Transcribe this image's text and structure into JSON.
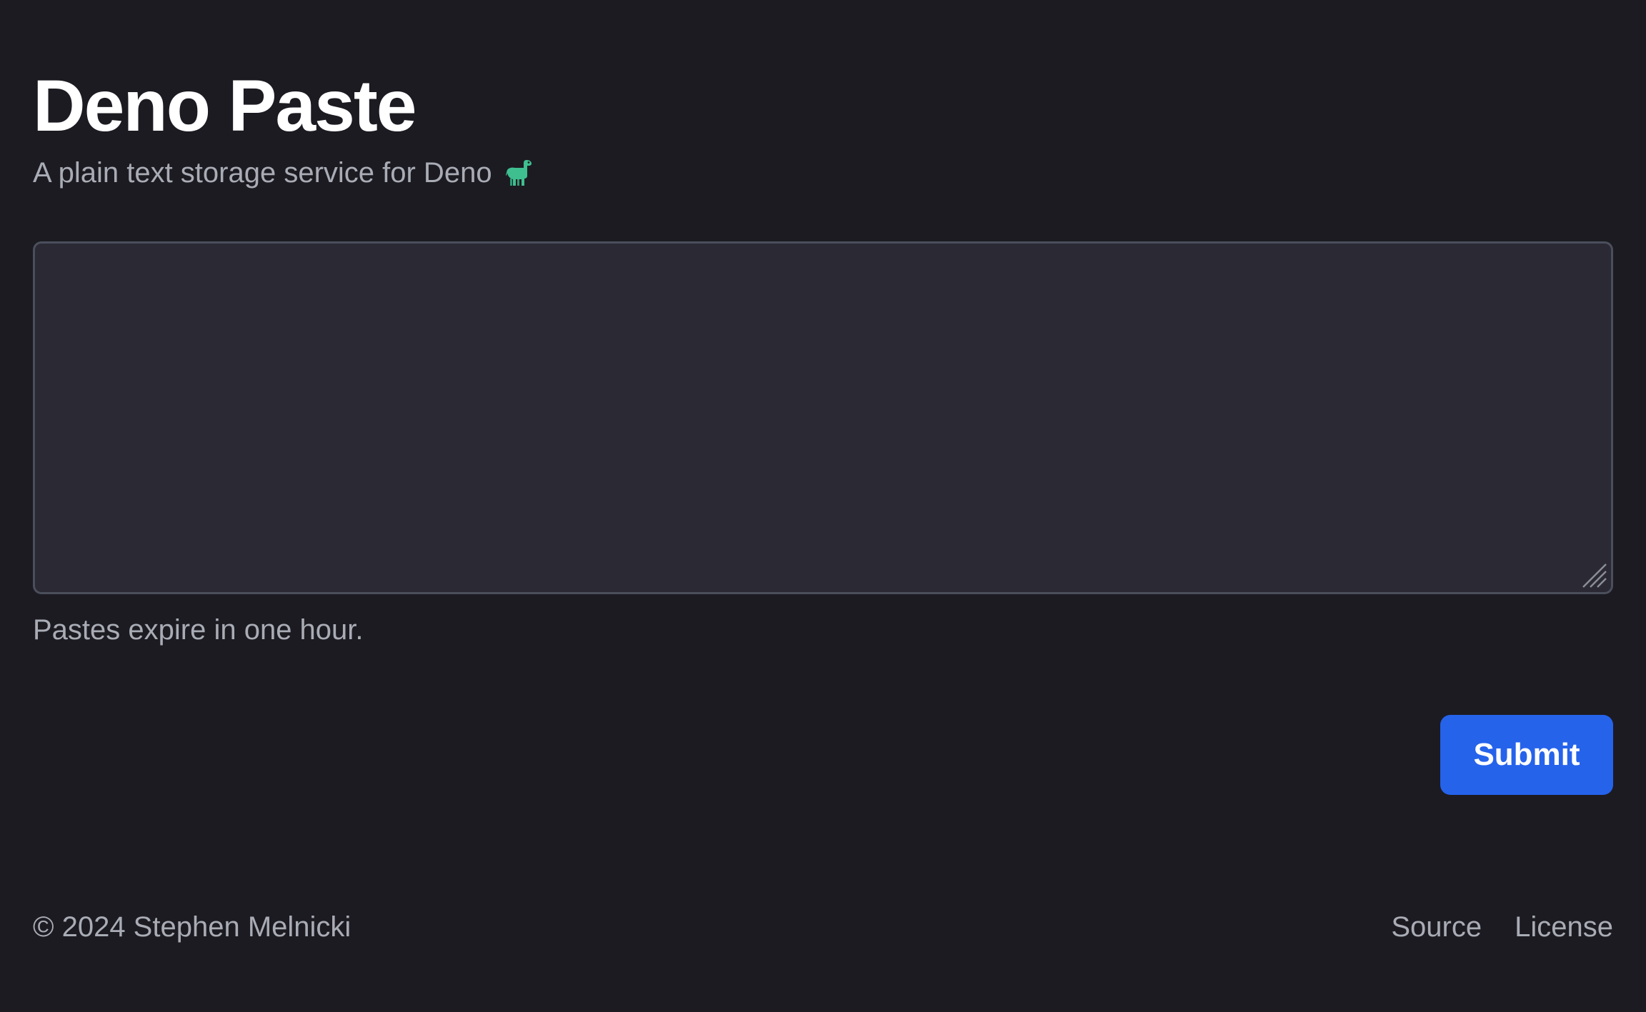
{
  "header": {
    "title": "Deno Paste",
    "subtitle": "A plain text storage service for Deno",
    "subtitle_icon": "sauropod-dinosaur-icon"
  },
  "paste": {
    "value": "",
    "placeholder": ""
  },
  "note": "Pastes expire in one hour.",
  "submit_label": "Submit",
  "footer": {
    "copyright": "© 2024 Stephen Melnicki",
    "links": [
      "Source",
      "License"
    ]
  },
  "colors": {
    "background": "#1c1b22",
    "textarea_bg": "#2a2934",
    "textarea_border": "#4b4f5c",
    "muted_text": "#a9acb5",
    "accent": "#2563eb",
    "dino": "#3fbf8f"
  }
}
